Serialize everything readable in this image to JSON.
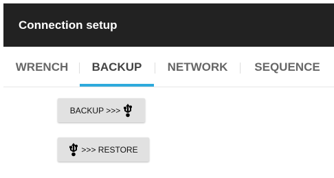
{
  "app_bar": {
    "title": "Connection setup"
  },
  "tabs": [
    {
      "label": "WRENCH",
      "active": false
    },
    {
      "label": "BACKUP",
      "active": true
    },
    {
      "label": "NETWORK",
      "active": false
    },
    {
      "label": "SEQUENCE",
      "active": false
    }
  ],
  "actions": {
    "backup_label": "BACKUP >>>",
    "backup_icon": "usb-icon",
    "restore_label": ">>> RESTORE",
    "restore_icon": "usb-icon"
  },
  "colors": {
    "app_bar_background": "#222222",
    "tab_indicator": "#2eaadc",
    "button_background": "#e1e1e1"
  }
}
